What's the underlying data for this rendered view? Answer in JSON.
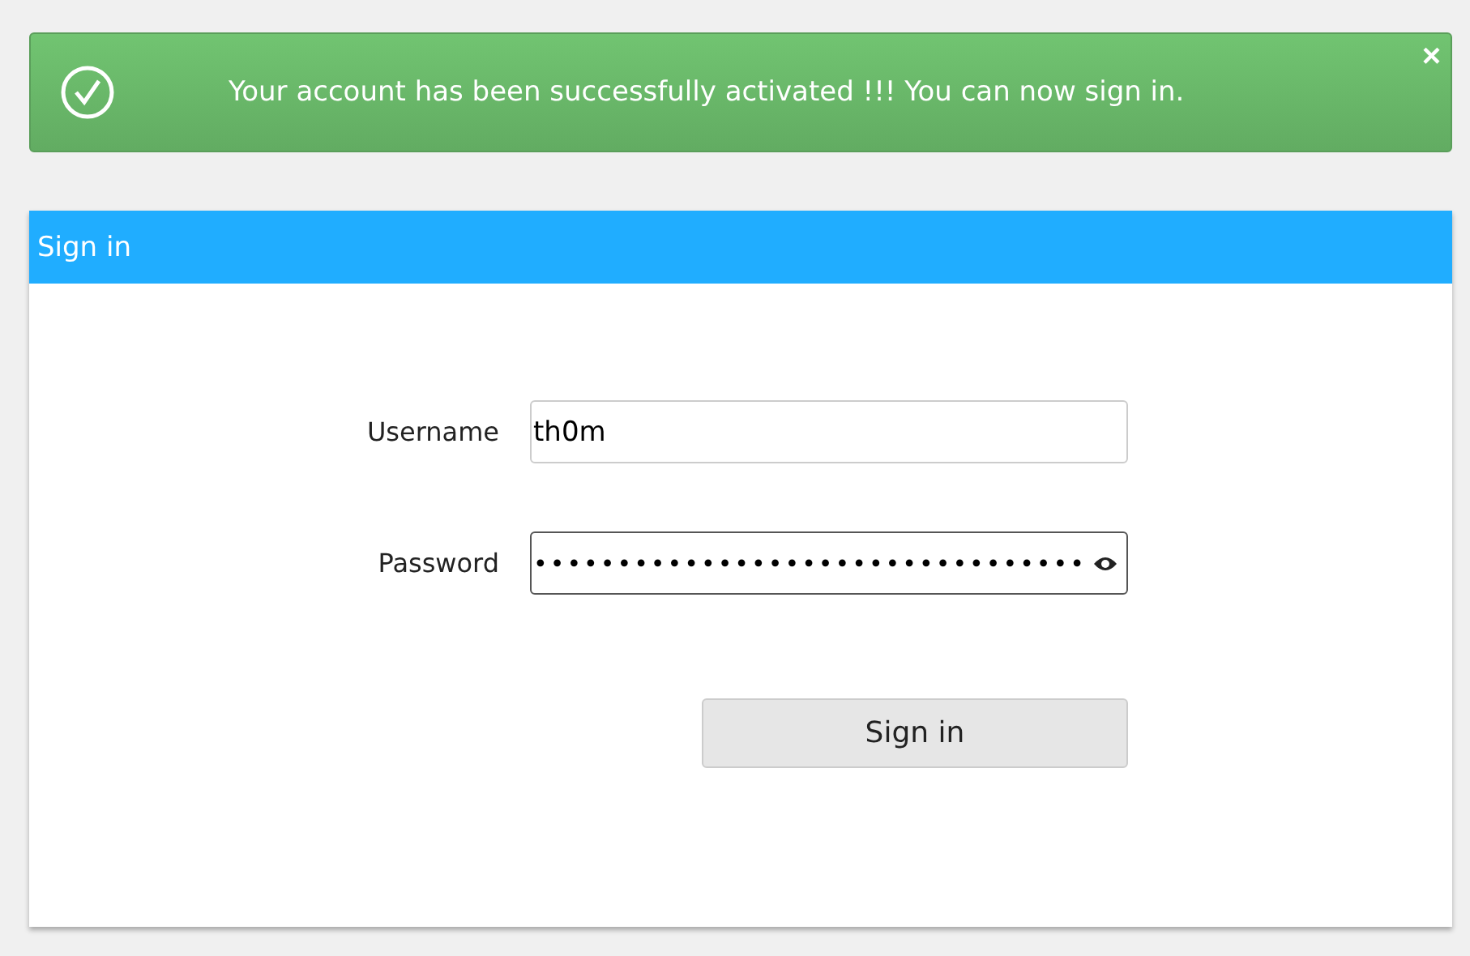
{
  "alert": {
    "message": "Your account has been successfully activated !!! You can now sign in.",
    "close": "×"
  },
  "panel": {
    "title": "Sign in"
  },
  "fields": [
    {
      "label": "Username",
      "value": "th0m",
      "kind": "text",
      "focused": false
    },
    {
      "label": "Password",
      "value": "•••••••••••••••••••••••••••••••••",
      "kind": "password",
      "focused": true
    }
  ],
  "submit": "Sign in"
}
